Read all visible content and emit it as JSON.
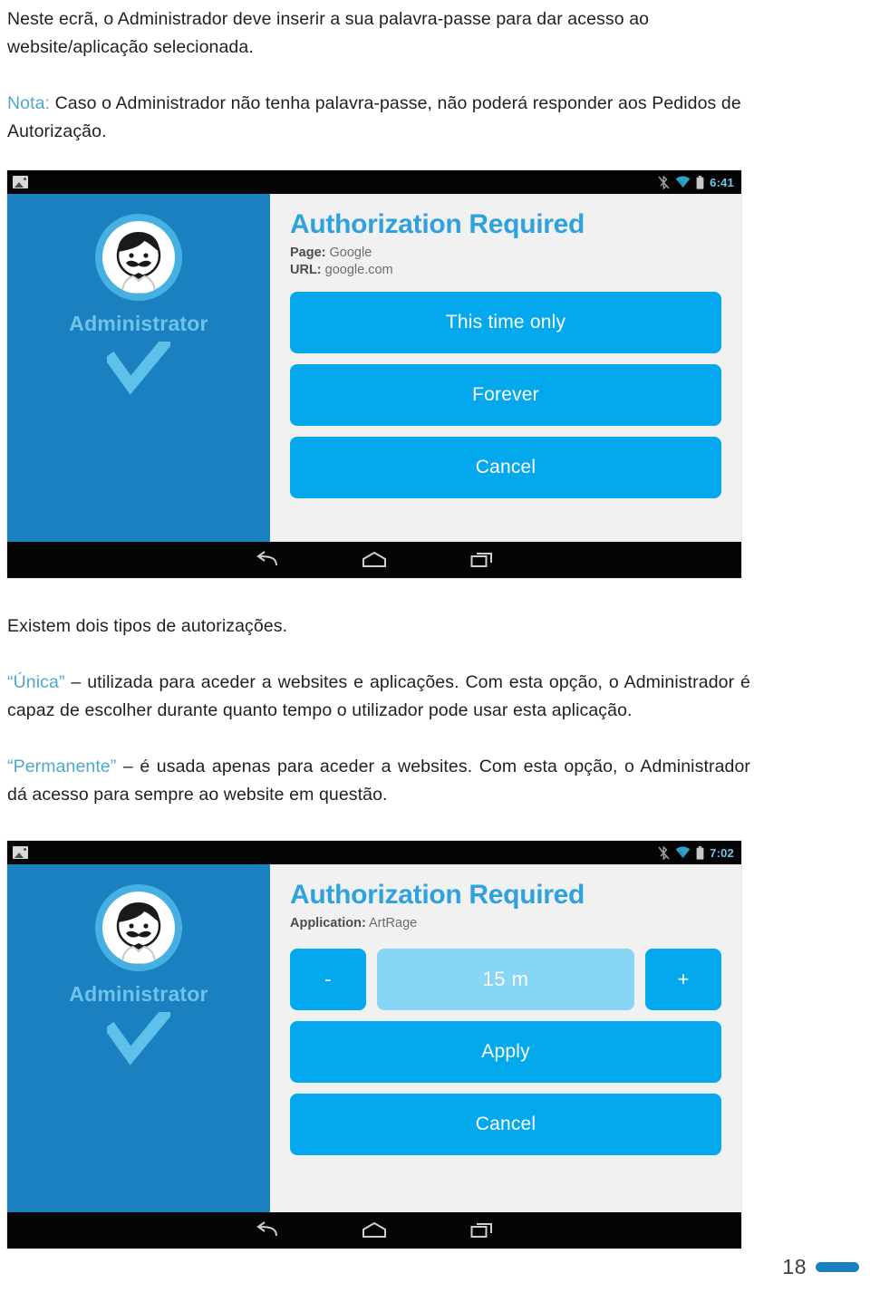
{
  "document": {
    "intro_paragraph": "Neste ecrã, o Administrador deve inserir a sua palavra-passe para dar acesso ao website/aplicação selecionada.",
    "note_label": "Nota:",
    "note_text": " Caso o Administrador não tenha palavra-passe, não poderá responder aos Pedidos de Autorização.",
    "types_intro": "Existem dois tipos de autorizações.",
    "type_single_label": "“Única”",
    "type_single_text": " – utilizada para aceder a websites e aplicações. Com esta opção, o Administrador é capaz de escolher durante quanto tempo o utilizador pode usar esta aplicação.",
    "type_permanent_label": "“Permanente”",
    "type_permanent_text": " – é usada apenas para aceder a websites. Com esta opção, o Administrador dá acesso para sempre ao website em questão.",
    "page_number": "18"
  },
  "screenshot_one": {
    "statusbar": {
      "image_icon": "image-icon",
      "bluetooth_icon": "bluetooth-icon",
      "wifi_icon": "wifi-icon",
      "battery_icon": "battery-icon",
      "time": "6:41"
    },
    "sidebar": {
      "avatar_icon": "administrator-avatar-icon",
      "user_label": "Administrator",
      "check_icon": "checkmark-icon"
    },
    "title": "Authorization Required",
    "meta": [
      {
        "label": "Page:",
        "value": " Google"
      },
      {
        "label": "URL:",
        "value": " google.com"
      }
    ],
    "buttons": [
      {
        "label": "This time only",
        "name": "this-time-only-button"
      },
      {
        "label": "Forever",
        "name": "forever-button"
      },
      {
        "label": "Cancel",
        "name": "cancel-button"
      }
    ],
    "navbar": {
      "back_icon": "back-icon",
      "home_icon": "home-icon",
      "recents_icon": "recent-apps-icon"
    }
  },
  "screenshot_two": {
    "statusbar": {
      "image_icon": "image-icon",
      "bluetooth_icon": "bluetooth-icon",
      "wifi_icon": "wifi-icon",
      "battery_icon": "battery-icon",
      "time": "7:02"
    },
    "sidebar": {
      "avatar_icon": "administrator-avatar-icon",
      "user_label": "Administrator",
      "check_icon": "checkmark-icon"
    },
    "title": "Authorization Required",
    "meta": [
      {
        "label": "Application:",
        "value": " ArtRage"
      }
    ],
    "stepper": {
      "decrement_label": "-",
      "value": "15 m",
      "increment_label": "+"
    },
    "buttons": [
      {
        "label": "Apply",
        "name": "apply-button"
      },
      {
        "label": "Cancel",
        "name": "cancel-button"
      }
    ],
    "navbar": {
      "back_icon": "back-icon",
      "home_icon": "home-icon",
      "recents_icon": "recent-apps-icon"
    }
  },
  "colors": {
    "accent_text": "#4fa8cf",
    "title_blue": "#2fa2de",
    "button_blue": "#03a9ec",
    "sidebar_blue": "#1b80bf",
    "value_blue": "#88d6f5",
    "status_time": "#6fc7e8"
  }
}
